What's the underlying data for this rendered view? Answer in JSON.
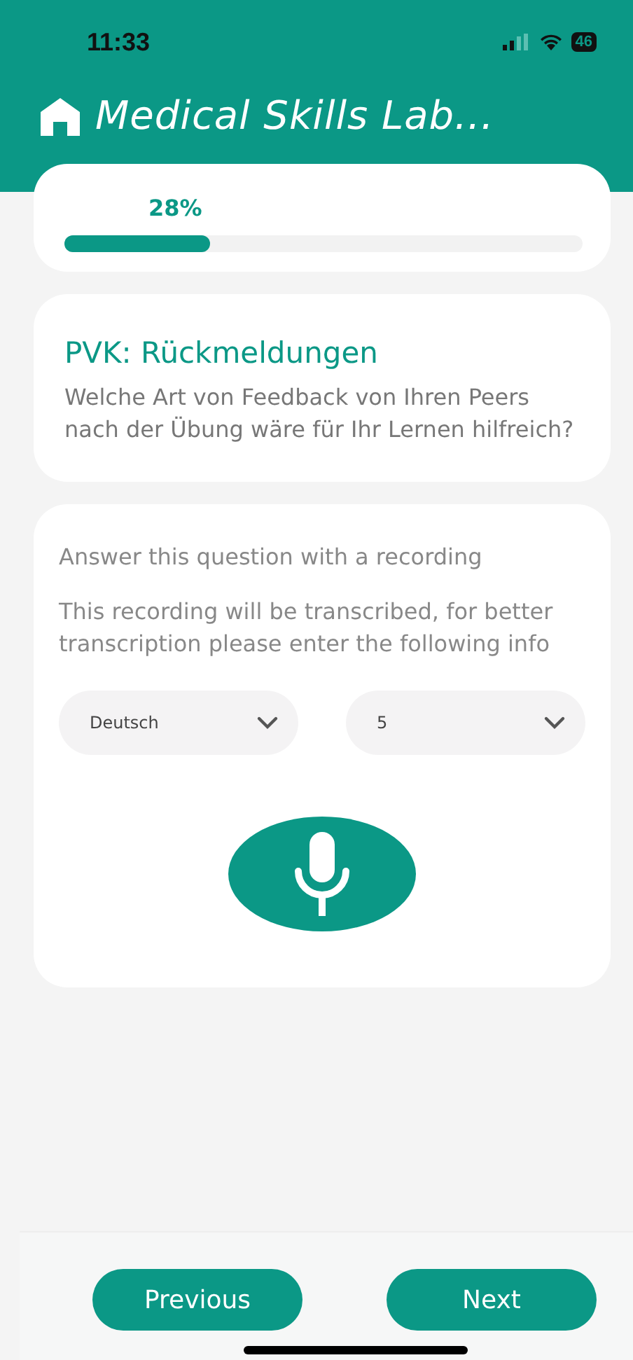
{
  "status_bar": {
    "time": "11:33",
    "battery": "46"
  },
  "header": {
    "title": "Medical Skills Lab..."
  },
  "progress": {
    "label": "28%",
    "level": 0.28
  },
  "question": {
    "title": "PVK: Rückmeldungen",
    "text": "Welche Art von Feedback von Ihren Peers nach der Übung wäre für Ihr Lernen hilfreich?"
  },
  "recording": {
    "instruction": "Answer this question with a recording",
    "info": "This recording will be transcribed, for better transcription please enter the following info",
    "dropdowns": [
      {
        "value": "Deutsch"
      },
      {
        "value": "5"
      }
    ]
  },
  "buttons": [
    "Previous",
    "Next"
  ]
}
